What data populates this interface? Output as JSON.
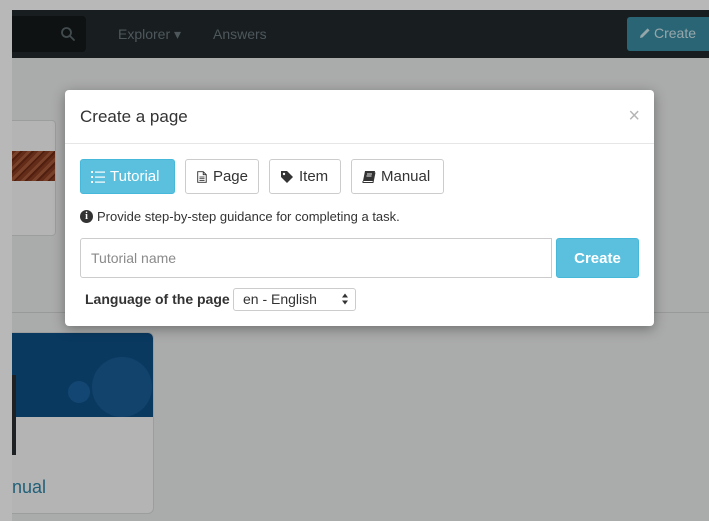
{
  "navbar": {
    "explorer_label": "Explorer ▾",
    "answers_label": "Answers",
    "create_label": "Create"
  },
  "background": {
    "card_title": "nual"
  },
  "modal": {
    "title": "Create a page",
    "close_label": "×",
    "type_buttons": [
      {
        "label": "Tutorial",
        "icon": "list-icon",
        "active": true
      },
      {
        "label": "Page",
        "icon": "file-icon",
        "active": false
      },
      {
        "label": "Item",
        "icon": "tag-icon",
        "active": false
      },
      {
        "label": "Manual",
        "icon": "book-icon",
        "active": false
      }
    ],
    "hint": "Provide step-by-step guidance for completing a task.",
    "name_input": {
      "placeholder": "Tutorial name",
      "value": ""
    },
    "create_label": "Create",
    "language_label": "Language of the page :",
    "language_value": "en - English"
  },
  "colors": {
    "accent": "#5bc0de",
    "navbar": "#22292b",
    "nav_create": "#3b8ca2",
    "card_link": "#2f86a8"
  }
}
